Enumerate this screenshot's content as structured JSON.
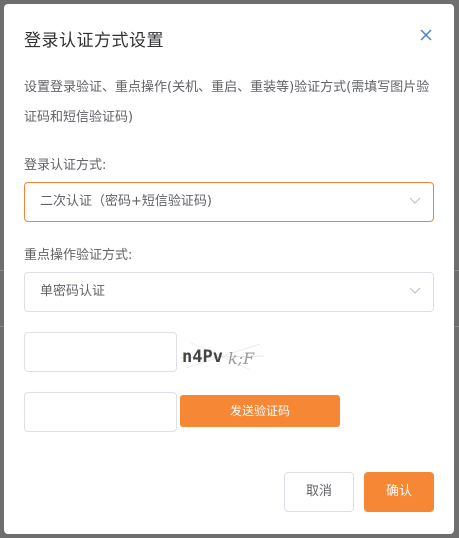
{
  "dialog": {
    "title": "登录认证方式设置",
    "description": "设置登录验证、重点操作(关机、重启、重装等)验证方式(需填写图片验证码和短信验证码)"
  },
  "login_auth": {
    "label": "登录认证方式:",
    "selected": "二次认证（密码+短信验证码)"
  },
  "key_op_auth": {
    "label": "重点操作验证方式:",
    "selected": "单密码认证"
  },
  "captcha": {
    "image_text": "n4Pv",
    "image_suffix": "k;F",
    "input_value": ""
  },
  "sms": {
    "input_value": "",
    "send_label": "发送验证码"
  },
  "footer": {
    "cancel_label": "取消",
    "confirm_label": "确认"
  },
  "colors": {
    "accent": "#f68734",
    "focus_border": "#f0853a",
    "close_icon": "#4a80c8"
  },
  "icons": [
    "close-icon",
    "chevron-down-icon"
  ]
}
